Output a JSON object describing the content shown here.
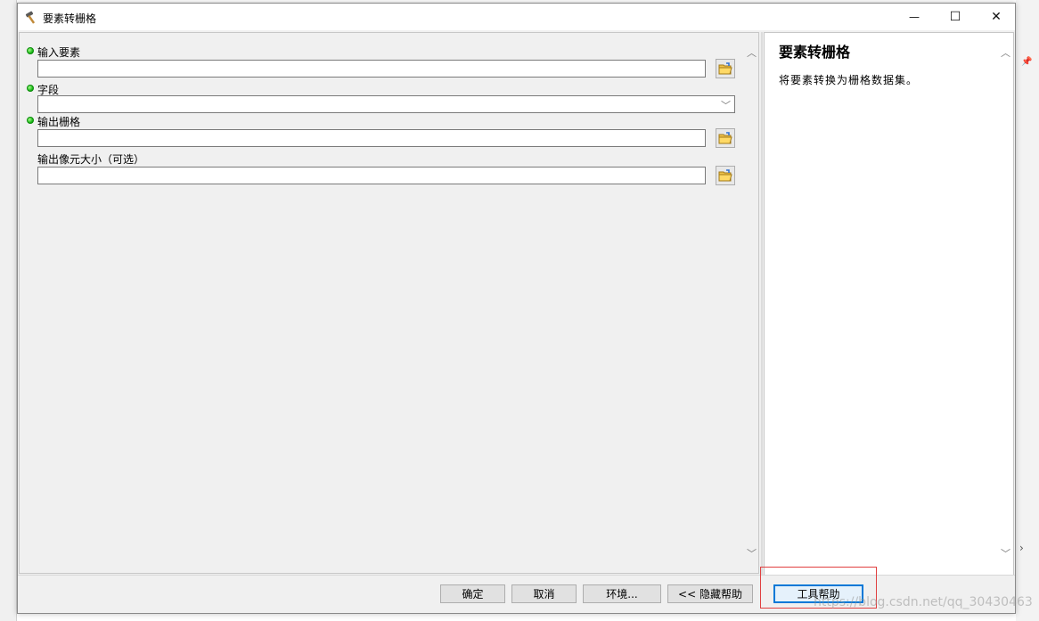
{
  "window": {
    "title": "要素转栅格",
    "controls": {
      "minimize": "—",
      "maximize": "☐",
      "close": "✕"
    }
  },
  "form": {
    "fields": [
      {
        "label": "输入要素",
        "required": true,
        "type": "text",
        "value": ""
      },
      {
        "label": "字段",
        "required": true,
        "type": "select",
        "value": ""
      },
      {
        "label": "输出栅格",
        "required": true,
        "type": "text",
        "value": ""
      },
      {
        "label": "输出像元大小（可选）",
        "required": false,
        "type": "text",
        "value": ""
      }
    ]
  },
  "help": {
    "title": "要素转栅格",
    "description": "将要素转换为栅格数据集。"
  },
  "buttons": {
    "ok": "确定",
    "cancel": "取消",
    "environments": "环境...",
    "hide_help": "<< 隐藏帮助",
    "tool_help": "工具帮助"
  },
  "watermark": "https://blog.csdn.net/qq_30430463",
  "icons": {
    "tool": "hammer-icon",
    "browse": "open-folder-icon",
    "dropdown": "chevron-down-icon",
    "scroll_up": "chevron-up-icon",
    "scroll_down": "chevron-down-icon"
  },
  "colors": {
    "required_dot": "#10b010",
    "focus_border": "#0078d7",
    "highlight_box": "#e04040"
  }
}
